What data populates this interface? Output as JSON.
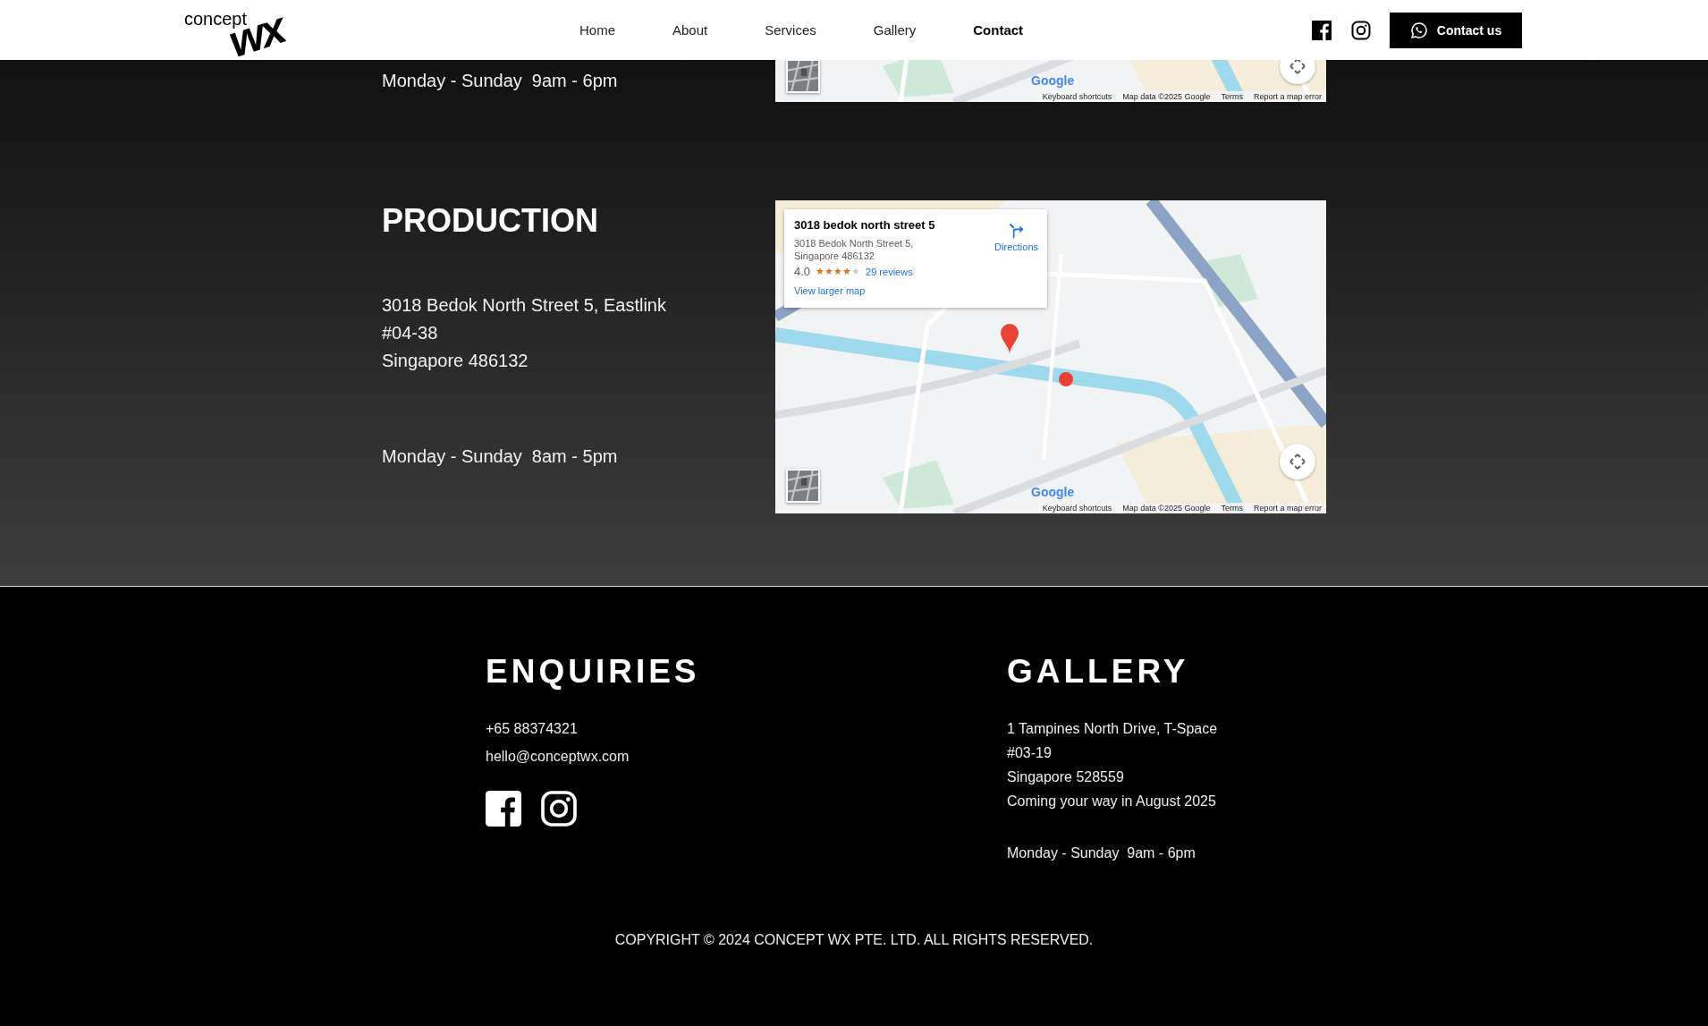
{
  "header": {
    "logo": {
      "word": "concept",
      "mark": "wx"
    },
    "nav": [
      {
        "label": "Home",
        "selected": false
      },
      {
        "label": "About",
        "selected": false
      },
      {
        "label": "Services",
        "selected": false
      },
      {
        "label": "Gallery",
        "selected": false
      },
      {
        "label": "Contact",
        "selected": true
      }
    ],
    "cta": "Contact us"
  },
  "locations": [
    {
      "kind": "cropped",
      "hours": "Monday - Sunday  9am - 6pm",
      "map": {
        "logo": "Google",
        "attribution": [
          "Keyboard shortcuts",
          "Map data ©2025 Google",
          "Terms",
          "Report a map error"
        ]
      }
    },
    {
      "kind": "full",
      "title": "PRODUCTION",
      "address": [
        "3018 Bedok North Street 5, Eastlink",
        "#04-38",
        "Singapore 486132"
      ],
      "hours": "Monday - Sunday  8am - 5pm",
      "map": {
        "logo": "Google",
        "attribution": [
          "Keyboard shortcuts",
          "Map data ©2025 Google",
          "Terms",
          "Report a map error"
        ],
        "card": {
          "name": "3018 bedok north street 5",
          "address": [
            "3018 Bedok North Street 5,",
            "Singapore 486132"
          ],
          "rating": "4.0",
          "stars": 4,
          "reviews": "29 reviews",
          "directions": "Directions",
          "link": "View larger map"
        }
      }
    }
  ],
  "footer": {
    "enquiries": {
      "title": "ENQUIRIES",
      "phone": "+65 88374321",
      "email": "hello@conceptwx.com"
    },
    "gallery": {
      "title": "GALLERY",
      "lines": [
        "1 Tampines North Drive, T-Space",
        "#03-19",
        "Singapore 528559",
        "Coming your way in August 2025"
      ],
      "hours": "Monday - Sunday  9am - 6pm"
    },
    "copyright": "COPYRIGHT © 2024 CONCEPT WX PTE. LTD. ALL RIGHTS RESERVED."
  }
}
